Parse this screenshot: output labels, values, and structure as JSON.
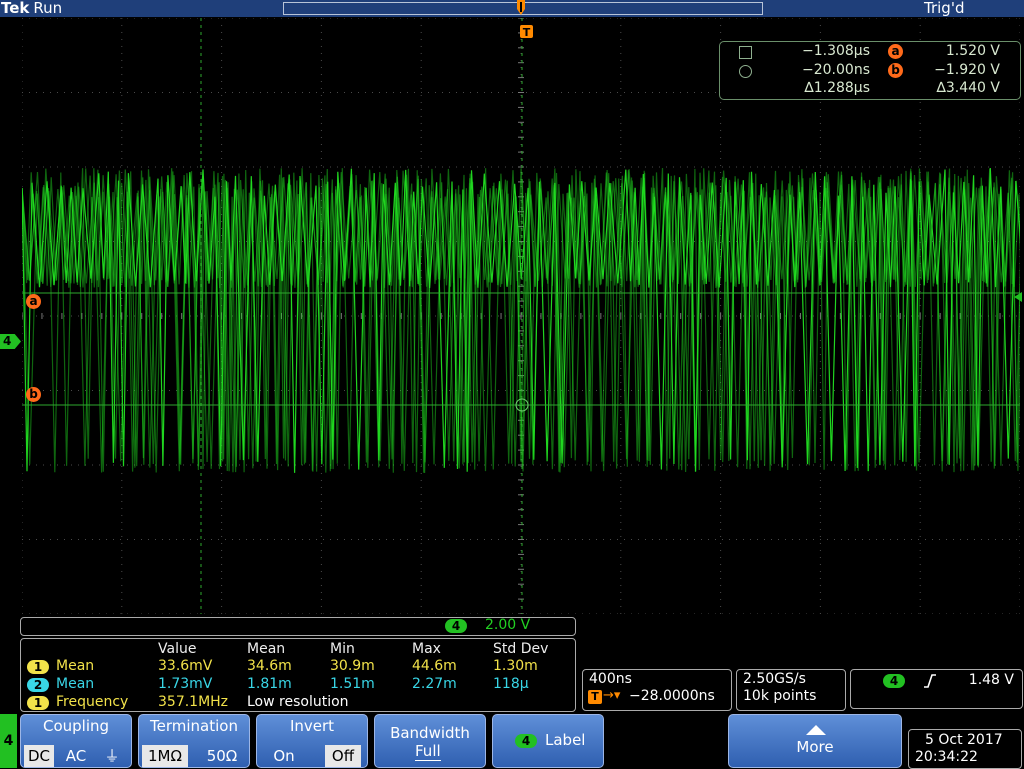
{
  "header": {
    "brand": "Tek",
    "run_state": "Run",
    "trigger_state": "Trig'd",
    "trigger_marker": "T"
  },
  "display": {
    "trace_color": "#22e022",
    "grid_color": "#4a4a4a",
    "channel_marker": "4",
    "cursor_a_label": "a",
    "cursor_b_label": "b"
  },
  "cursors": {
    "time1": "−1.308µs",
    "time2": "−20.00ns",
    "delta_time": "∆1.288µs",
    "a_label": "a",
    "b_label": "b",
    "a_value": "1.520 V",
    "b_value": "−1.920 V",
    "delta_value": "∆3.440 V",
    "icon1": "square-icon",
    "icon2": "circle-icon"
  },
  "channel_scale": {
    "channel": "4",
    "value": "2.00 V"
  },
  "measurements": {
    "headers": [
      "Value",
      "Mean",
      "Min",
      "Max",
      "Std Dev"
    ],
    "rows": [
      {
        "chip": "1",
        "name": "Mean",
        "value": "33.6mV",
        "mean": "34.6m",
        "min": "30.9m",
        "max": "44.6m",
        "std": "1.30m",
        "color": "#f2e24a"
      },
      {
        "chip": "2",
        "name": "Mean",
        "value": "1.73mV",
        "mean": "1.81m",
        "min": "1.51m",
        "max": "2.27m",
        "std": "118µ",
        "color": "#39d6e6"
      },
      {
        "chip": "1",
        "name": "Frequency",
        "value": "357.1MHz",
        "note": "Low resolution",
        "color": "#f2e24a"
      }
    ]
  },
  "timebase": {
    "scale": "400ns",
    "position": "−28.0000ns",
    "sample_rate": "2.50GS/s",
    "record_length": "10k points"
  },
  "trigger": {
    "channel": "4",
    "slope": "rising",
    "level": "1.48 V"
  },
  "menu": {
    "channel": "4",
    "coupling": {
      "label": "Coupling",
      "options": [
        "DC",
        "AC",
        "⏚"
      ],
      "selected": "DC"
    },
    "termination": {
      "label": "Termination",
      "options": [
        "1MΩ",
        "50Ω"
      ],
      "selected": "1MΩ"
    },
    "invert": {
      "label": "Invert",
      "options": [
        "On",
        "Off"
      ],
      "selected": "Off"
    },
    "bandwidth": {
      "label": "Bandwidth",
      "value": "Full"
    },
    "label_btn": {
      "chip": "4",
      "label": "Label"
    },
    "more": {
      "label": "More"
    }
  },
  "datetime": {
    "date": "5 Oct  2017",
    "time": "20:34:22"
  }
}
